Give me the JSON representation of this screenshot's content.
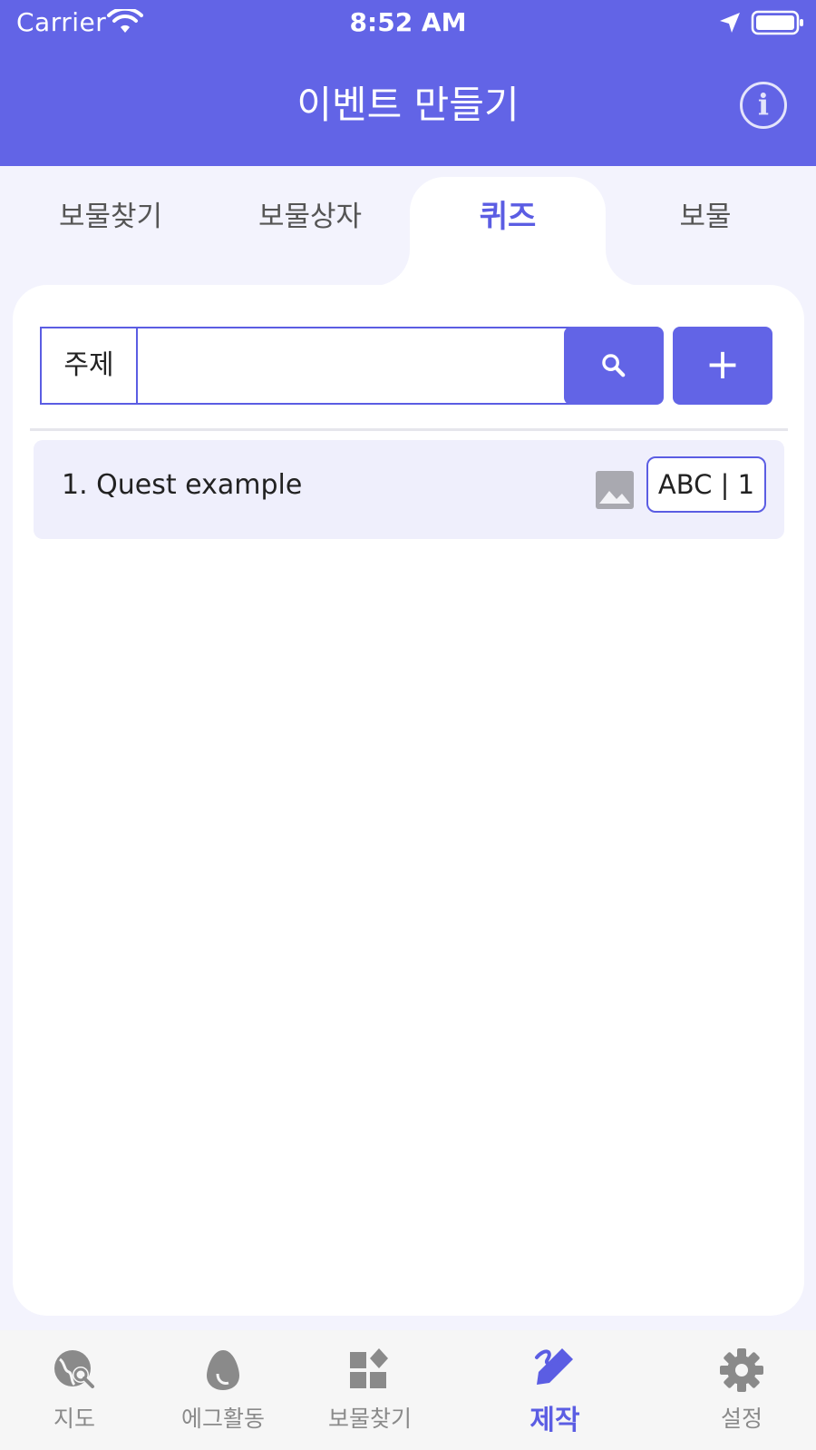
{
  "status_bar": {
    "carrier": "Carrier",
    "time": "8:52 AM"
  },
  "header": {
    "title": "이벤트 만들기",
    "info_icon": "info-icon"
  },
  "tabs": [
    {
      "label": "보물찾기",
      "active": false
    },
    {
      "label": "보물상자",
      "active": false
    },
    {
      "label": "퀴즈",
      "active": true
    },
    {
      "label": "보물",
      "active": false
    }
  ],
  "search": {
    "label": "주제",
    "value": "",
    "placeholder": "",
    "search_icon": "search-icon",
    "add_label": "+"
  },
  "quests": [
    {
      "title": "1. Quest example",
      "icon": "image-icon",
      "badge": "ABC | 1"
    }
  ],
  "bottom_nav": [
    {
      "label": "지도",
      "icon": "globe-search-icon",
      "active": false
    },
    {
      "label": "에그활동",
      "icon": "egg-icon",
      "active": false
    },
    {
      "label": "보물찾기",
      "icon": "widgets-icon",
      "active": false
    },
    {
      "label": "제작",
      "icon": "pen-icon",
      "active": true
    },
    {
      "label": "설정",
      "icon": "gear-icon",
      "active": false
    }
  ],
  "colors": {
    "primary": "#6264e6",
    "accent_text": "#5b5de3",
    "background": "#f3f3fd",
    "row_background": "#efeffc",
    "inactive": "#8a8a8a"
  }
}
